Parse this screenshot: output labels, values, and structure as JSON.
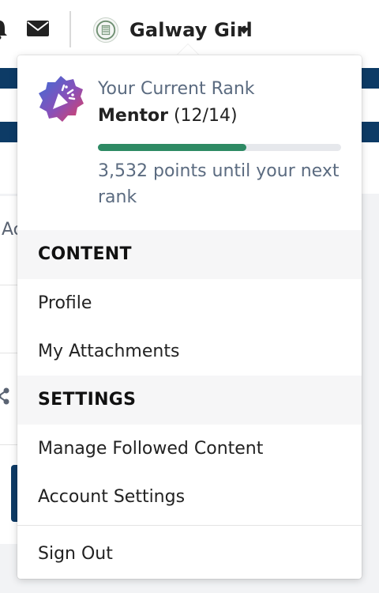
{
  "header": {
    "username": "Galway Girl",
    "icons": [
      "bell-icon",
      "mail-icon",
      "avatar-crest-icon",
      "caret-down-icon"
    ]
  },
  "background": {
    "partial_text": "Ac",
    "icons": [
      "share-icon"
    ]
  },
  "rank": {
    "caption": "Your Current Rank",
    "name": "Mentor",
    "level": "(12/14)",
    "progress_fraction": 0.61,
    "points_message": "3,532 points until your next rank",
    "badge_icon": "party-popper-badge-icon"
  },
  "sections": {
    "content_title": "CONTENT",
    "settings_title": "SETTINGS"
  },
  "menu": {
    "profile": "Profile",
    "attachments": "My Attachments",
    "followed": "Manage Followed Content",
    "account": "Account Settings",
    "signout": "Sign Out"
  },
  "colors": {
    "progress": "#2e8a64",
    "navy": "#0d3b66",
    "muted_text": "#5b6b80"
  }
}
